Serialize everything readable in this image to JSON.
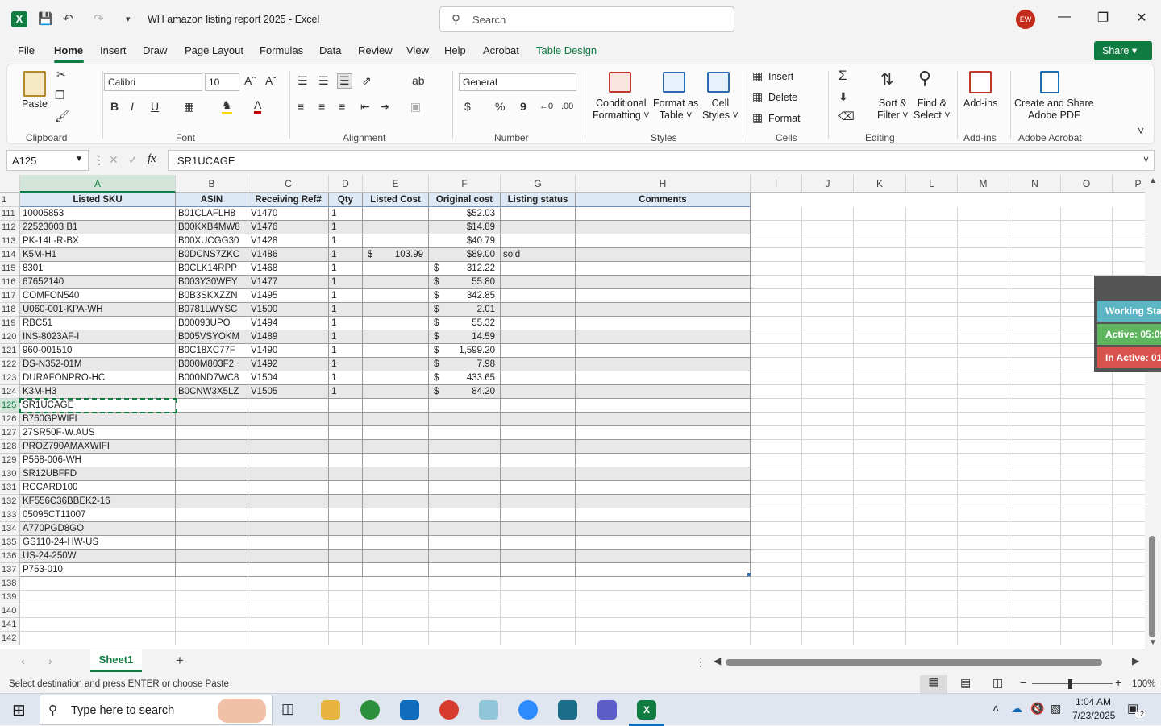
{
  "app": {
    "doc_title": "WH amazon listing report 2025  -  Excel",
    "search_placeholder": "Search",
    "user_initials": "EW",
    "share_label": "Share"
  },
  "menu": [
    "File",
    "Home",
    "Insert",
    "Draw",
    "Page Layout",
    "Formulas",
    "Data",
    "Review",
    "View",
    "Help",
    "Acrobat",
    "Table Design"
  ],
  "ribbon": {
    "clipboard": {
      "paste": "Paste",
      "label": "Clipboard"
    },
    "font": {
      "name": "Calibri",
      "size": "10",
      "label": "Font",
      "bold": "B",
      "italic": "I",
      "underline": "U"
    },
    "alignment": {
      "label": "Alignment"
    },
    "number": {
      "format": "General",
      "label": "Number",
      "currency": "$",
      "percent": "%",
      "comma": "9"
    },
    "styles": {
      "conditional": "Conditional",
      "conditional2": "Formatting",
      "format_table": "Format as",
      "format_table2": "Table",
      "cell_styles": "Cell",
      "cell_styles2": "Styles",
      "label": "Styles"
    },
    "cells": {
      "insert": "Insert",
      "delete": "Delete",
      "format": "Format",
      "label": "Cells"
    },
    "editing": {
      "sort": "Sort &",
      "sort2": "Filter",
      "find": "Find &",
      "find2": "Select",
      "label": "Editing"
    },
    "addins": {
      "addins": "Add-ins",
      "label": "Add-ins"
    },
    "acrobat": {
      "create": "Create and Share",
      "create2": "Adobe PDF",
      "label": "Adobe Acrobat"
    }
  },
  "formula": {
    "namebox": "A125",
    "fx": "fx",
    "content": "SR1UCAGE"
  },
  "columns": [
    "A",
    "B",
    "C",
    "D",
    "E",
    "F",
    "G",
    "H",
    "I",
    "J",
    "K",
    "L",
    "M",
    "N",
    "O",
    "P"
  ],
  "table_headers": [
    "Listed SKU",
    "ASIN",
    "Receiving Ref#",
    "Qty",
    "Listed Cost",
    "Original cost",
    "Listing status",
    "Comments"
  ],
  "rows": [
    {
      "n": "111",
      "sku": "10005853",
      "asin": "B01CLAFLH8",
      "ref": "V1470",
      "qty": "1",
      "lc_s": "",
      "lc": "",
      "oc_s": "",
      "oc": "$52.03",
      "status": ""
    },
    {
      "n": "112",
      "sku": "22523003 B1",
      "asin": "B00KXB4MW8",
      "ref": "V1476",
      "qty": "1",
      "lc_s": "",
      "lc": "",
      "oc_s": "",
      "oc": "$14.89",
      "status": ""
    },
    {
      "n": "113",
      "sku": "PK-14L-R-BX",
      "asin": "B00XUCGG30",
      "ref": "V1428",
      "qty": "1",
      "lc_s": "",
      "lc": "",
      "oc_s": "",
      "oc": "$40.79",
      "status": ""
    },
    {
      "n": "114",
      "sku": "K5M-H1",
      "asin": "B0DCNS7ZKC",
      "ref": "V1486",
      "qty": "1",
      "lc_s": "$",
      "lc": "103.99",
      "oc_s": "",
      "oc": "$89.00",
      "status": "sold"
    },
    {
      "n": "115",
      "sku": "8301",
      "asin": "B0CLK14RPP",
      "ref": "V1468",
      "qty": "1",
      "lc_s": "",
      "lc": "",
      "oc_s": "$",
      "oc": "312.22",
      "status": ""
    },
    {
      "n": "116",
      "sku": "67652140",
      "asin": "B003Y30WEY",
      "ref": "V1477",
      "qty": "1",
      "lc_s": "",
      "lc": "",
      "oc_s": "$",
      "oc": "55.80",
      "status": ""
    },
    {
      "n": "117",
      "sku": "COMFON540",
      "asin": "B0B3SKXZZN",
      "ref": "V1495",
      "qty": "1",
      "lc_s": "",
      "lc": "",
      "oc_s": "$",
      "oc": "342.85",
      "status": ""
    },
    {
      "n": "118",
      "sku": "U060-001-KPA-WH",
      "asin": "B0781LWYSC",
      "ref": "V1500",
      "qty": "1",
      "lc_s": "",
      "lc": "",
      "oc_s": "$",
      "oc": "2.01",
      "status": ""
    },
    {
      "n": "119",
      "sku": "RBC51",
      "asin": "B00093UPO",
      "ref": "V1494",
      "qty": "1",
      "lc_s": "",
      "lc": "",
      "oc_s": "$",
      "oc": "55.32",
      "status": ""
    },
    {
      "n": "120",
      "sku": "INS-8023AF-I",
      "asin": "B005VSYOKM",
      "ref": "V1489",
      "qty": "1",
      "lc_s": "",
      "lc": "",
      "oc_s": "$",
      "oc": "14.59",
      "status": ""
    },
    {
      "n": "121",
      "sku": "960-001510",
      "asin": "B0C18XC77F",
      "ref": "V1490",
      "qty": "1",
      "lc_s": "",
      "lc": "",
      "oc_s": "$",
      "oc": "1,599.20",
      "status": ""
    },
    {
      "n": "122",
      "sku": "DS-N352-01M",
      "asin": "B000M803F2",
      "ref": "V1492",
      "qty": "1",
      "lc_s": "",
      "lc": "",
      "oc_s": "$",
      "oc": "7.98",
      "status": ""
    },
    {
      "n": "123",
      "sku": "DURAFONPRO-HC",
      "asin": "B000ND7WC8",
      "ref": "V1504",
      "qty": "1",
      "lc_s": "",
      "lc": "",
      "oc_s": "$",
      "oc": "433.65",
      "status": ""
    },
    {
      "n": "124",
      "sku": "K3M-H3",
      "asin": "B0CNW3X5LZ",
      "ref": "V1505",
      "qty": "1",
      "lc_s": "",
      "lc": "",
      "oc_s": "$",
      "oc": "84.20",
      "status": ""
    },
    {
      "n": "125",
      "sku": "SR1UCAGE",
      "asin": "",
      "ref": "",
      "qty": "",
      "lc_s": "",
      "lc": "",
      "oc_s": "",
      "oc": "",
      "status": ""
    },
    {
      "n": "126",
      "sku": "B760GPWIFI",
      "asin": "",
      "ref": "",
      "qty": "",
      "lc_s": "",
      "lc": "",
      "oc_s": "",
      "oc": "",
      "status": ""
    },
    {
      "n": "127",
      "sku": "27SR50F-W.AUS",
      "asin": "",
      "ref": "",
      "qty": "",
      "lc_s": "",
      "lc": "",
      "oc_s": "",
      "oc": "",
      "status": ""
    },
    {
      "n": "128",
      "sku": "PROZ790AMAXWIFI",
      "asin": "",
      "ref": "",
      "qty": "",
      "lc_s": "",
      "lc": "",
      "oc_s": "",
      "oc": "",
      "status": ""
    },
    {
      "n": "129",
      "sku": "P568-006-WH",
      "asin": "",
      "ref": "",
      "qty": "",
      "lc_s": "",
      "lc": "",
      "oc_s": "",
      "oc": "",
      "status": ""
    },
    {
      "n": "130",
      "sku": "SR12UBFFD",
      "asin": "",
      "ref": "",
      "qty": "",
      "lc_s": "",
      "lc": "",
      "oc_s": "",
      "oc": "",
      "status": ""
    },
    {
      "n": "131",
      "sku": "RCCARD100",
      "asin": "",
      "ref": "",
      "qty": "",
      "lc_s": "",
      "lc": "",
      "oc_s": "",
      "oc": "",
      "status": ""
    },
    {
      "n": "132",
      "sku": "KF556C36BBEK2-16",
      "asin": "",
      "ref": "",
      "qty": "",
      "lc_s": "",
      "lc": "",
      "oc_s": "",
      "oc": "",
      "status": ""
    },
    {
      "n": "133",
      "sku": "05095CT11007",
      "asin": "",
      "ref": "",
      "qty": "",
      "lc_s": "",
      "lc": "",
      "oc_s": "",
      "oc": "",
      "status": ""
    },
    {
      "n": "134",
      "sku": "A770PGD8GO",
      "asin": "",
      "ref": "",
      "qty": "",
      "lc_s": "",
      "lc": "",
      "oc_s": "",
      "oc": "",
      "status": ""
    },
    {
      "n": "135",
      "sku": "GS110-24-HW-US",
      "asin": "",
      "ref": "",
      "qty": "",
      "lc_s": "",
      "lc": "",
      "oc_s": "",
      "oc": "",
      "status": ""
    },
    {
      "n": "136",
      "sku": "US-24-250W",
      "asin": "",
      "ref": "",
      "qty": "",
      "lc_s": "",
      "lc": "",
      "oc_s": "",
      "oc": "",
      "status": ""
    },
    {
      "n": "137",
      "sku": "P753-010",
      "asin": "",
      "ref": "",
      "qty": "",
      "lc_s": "",
      "lc": "",
      "oc_s": "",
      "oc": "",
      "status": ""
    }
  ],
  "empty_rows": [
    "138",
    "139",
    "140",
    "141",
    "142"
  ],
  "sheet_tab": "Sheet1",
  "status_text": "Select destination and press ENTER or choose Paste",
  "zoom": "100%",
  "float_panel": {
    "working": "Working Sta",
    "active": "Active: 05:09",
    "inactive": "In Active: 01"
  },
  "taskbar": {
    "search": "Type here to search",
    "time": "1:04 AM",
    "date": "7/23/2025",
    "notif": "12"
  },
  "colors": {
    "accent": "#107c41",
    "header_fill": "#dde9f5",
    "band": "#e8e8e8"
  }
}
